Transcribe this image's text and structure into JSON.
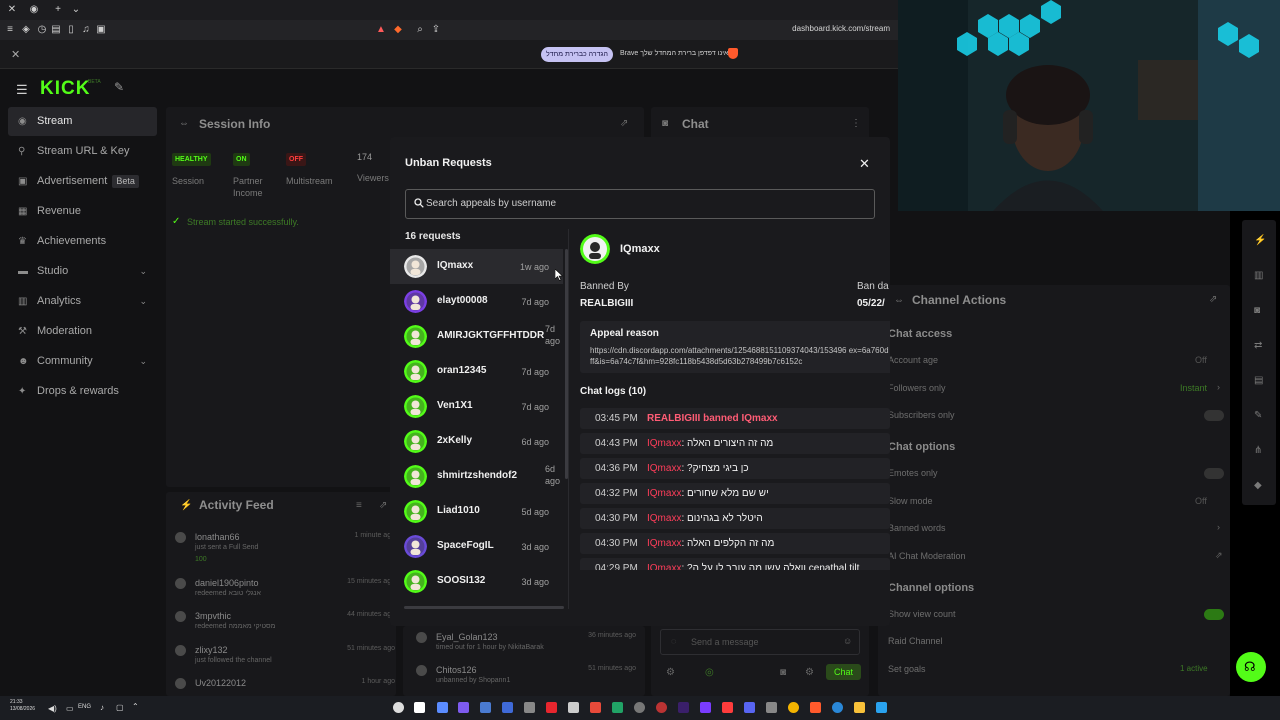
{
  "browser": {
    "url": "dashboard.kick.com/stream",
    "notification": {
      "button": "הגדרה כברירת מחדל",
      "text": "Brave אינו דפדפן ברירת המחדל שלך"
    }
  },
  "app": {
    "logo": "KICK",
    "logo_badge": "BETA",
    "sidebar": [
      {
        "label": "Stream",
        "icon": "stream-icon",
        "active": true
      },
      {
        "label": "Stream URL & Key",
        "icon": "key-icon"
      },
      {
        "label": "Advertisement",
        "icon": "ad-icon",
        "badge": "Beta"
      },
      {
        "label": "Revenue",
        "icon": "revenue-icon"
      },
      {
        "label": "Achievements",
        "icon": "trophy-icon"
      },
      {
        "label": "Studio",
        "icon": "studio-icon",
        "expandable": true
      },
      {
        "label": "Analytics",
        "icon": "analytics-icon",
        "expandable": true
      },
      {
        "label": "Moderation",
        "icon": "moderation-icon"
      },
      {
        "label": "Community",
        "icon": "community-icon",
        "expandable": true
      },
      {
        "label": "Drops & rewards",
        "icon": "gift-icon"
      }
    ]
  },
  "session": {
    "title": "Session Info",
    "stats": [
      {
        "badge": "HEALTHY",
        "label": "Session",
        "color": "#53fc18"
      },
      {
        "badge": "ON",
        "label": "Partner Income",
        "color": "#53fc18"
      },
      {
        "badge": "OFF",
        "label": "Multistream",
        "color": "#ff3d3d"
      },
      {
        "badge": "174",
        "label": "Viewers"
      }
    ],
    "status_text": "Stream started successfully."
  },
  "chat": {
    "title": "Chat",
    "input_placeholder": "Send a message",
    "send_label": "Chat"
  },
  "activity": {
    "title": "Activity Feed",
    "rows": [
      {
        "name": "lonathan66",
        "sub": "just sent a Full Send",
        "extra": "100",
        "time": "1 minute ago"
      },
      {
        "name": "daniel1906pinto",
        "sub": "redeemed אנגלי טובא",
        "time": "15 minutes ago"
      },
      {
        "name": "3mpvthic",
        "sub": "redeemed מסטיקי מאממה",
        "time": "44 minutes ago"
      },
      {
        "name": "zlixy132",
        "sub": "just followed the channel",
        "time": "51 minutes ago"
      },
      {
        "name": "Uv20122012",
        "sub": "",
        "time": "1 hour ago"
      }
    ],
    "rows2": [
      {
        "name": "Eyal_Golan123",
        "sub": "timed out for 1 hour by NikitaBarak",
        "time": "36 minutes ago"
      },
      {
        "name": "Chitos126",
        "sub": "unbanned by Shopann1",
        "time": "51 minutes ago"
      }
    ]
  },
  "channel_actions": {
    "title": "Channel Actions",
    "sections": [
      {
        "heading": "Chat access",
        "items": [
          {
            "label": "Account age",
            "value": "Off"
          },
          {
            "label": "Followers only",
            "value": "Instant"
          },
          {
            "label": "Subscribers only",
            "value": ""
          }
        ]
      },
      {
        "heading": "Chat options",
        "items": [
          {
            "label": "Emotes only",
            "value": ""
          },
          {
            "label": "Slow mode",
            "value": "Off"
          },
          {
            "label": "Banned words",
            "value": ""
          },
          {
            "label": "AI Chat Moderation",
            "value": ""
          }
        ]
      },
      {
        "heading": "Channel options",
        "items": [
          {
            "label": "Show view count",
            "value": ""
          },
          {
            "label": "Raid Channel",
            "value": ""
          },
          {
            "label": "Set goals",
            "value": "1 active"
          }
        ]
      }
    ]
  },
  "modal": {
    "title": "Unban Requests",
    "search_placeholder": "Search appeals by username",
    "count_label": "16 requests",
    "requests": [
      {
        "name": "IQmaxx",
        "ago": "1w ago",
        "selected": true,
        "color": "#e8e8e8"
      },
      {
        "name": "elayt00008",
        "ago": "7d ago",
        "color": "#7b3fe4"
      },
      {
        "name": "AMIRJGKTGFFHTDDR",
        "ago": "7d ago",
        "color": "#53fc18"
      },
      {
        "name": "oran12345",
        "ago": "7d ago",
        "color": "#53fc18"
      },
      {
        "name": "Ven1X1",
        "ago": "7d ago",
        "color": "#53fc18"
      },
      {
        "name": "2xKelly",
        "ago": "6d ago",
        "color": "#53fc18"
      },
      {
        "name": "shmirtzshendof2",
        "ago": "6d ago",
        "color": "#53fc18"
      },
      {
        "name": "Liad1010",
        "ago": "5d ago",
        "color": "#53fc18"
      },
      {
        "name": "SpaceFogIL",
        "ago": "3d ago",
        "color": "#6a4bd8"
      },
      {
        "name": "SOOSI132",
        "ago": "3d ago",
        "color": "#53fc18"
      }
    ],
    "detail": {
      "name": "IQmaxx",
      "banned_by_label": "Banned By",
      "banned_by": "REALBIGIII",
      "ban_date_label": "Ban da",
      "ban_date": "05/22/",
      "appeal_label": "Appeal reason",
      "appeal_text": "https://cdn.discordapp.com/attachments/1254688151109374043/153496 ex=6a760dff&is=6a74c7f&hm=928fc118b5438d5d63b278499b7c6152c",
      "chat_logs_label": "Chat logs (10)",
      "logs": [
        {
          "time": "03:45 PM",
          "system": "REALBIGIII banned IQmaxx"
        },
        {
          "time": "04:43 PM",
          "user": "IQmaxx",
          "text": "מה זה היצורים האלה"
        },
        {
          "time": "04:36 PM",
          "user": "IQmaxx",
          "text": "?כן ביגי מצחיק"
        },
        {
          "time": "04:32 PM",
          "user": "IQmaxx",
          "text": "יש שם מלא שחורים"
        },
        {
          "time": "04:30 PM",
          "user": "IQmaxx",
          "text": "היטלר לא בגהינום"
        },
        {
          "time": "04:30 PM",
          "user": "IQmaxx",
          "text": "מה זה הקלפים האלה"
        },
        {
          "time": "04:29 PM",
          "user": "IQmaxx",
          "text": "?וואלה עשו מה עובר לו על ה cenathal tilt"
        }
      ]
    }
  },
  "taskbar": {
    "time": "21:33",
    "date": "13/08/2026",
    "lang": "ENG"
  }
}
